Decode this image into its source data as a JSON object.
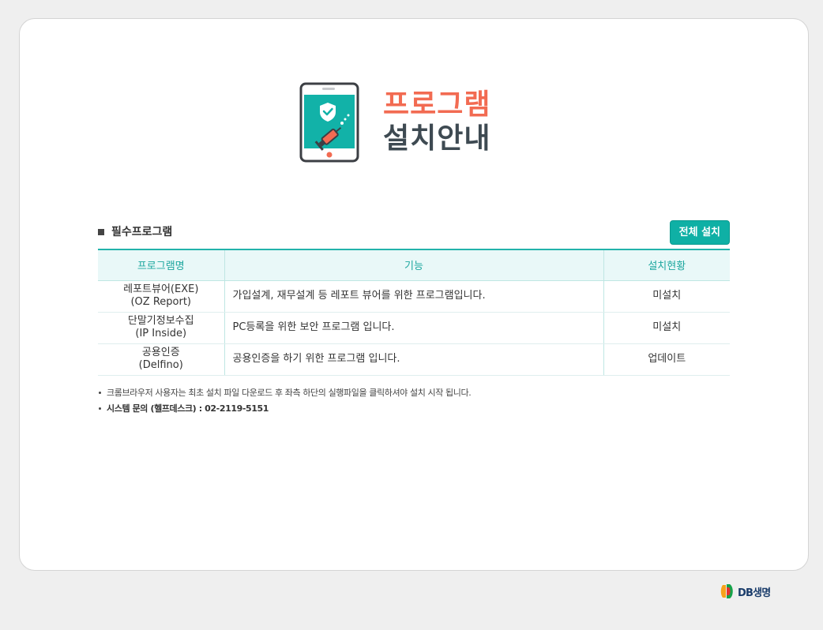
{
  "header": {
    "title": "프로그램",
    "subtitle": "설치안내"
  },
  "section": {
    "title": "필수프로그램",
    "install_all_label": "전체 설치"
  },
  "table": {
    "columns": [
      "프로그램명",
      "기능",
      "설치현황"
    ],
    "rows": [
      {
        "name": "레포트뷰어(EXE)",
        "sub": "(OZ Report)",
        "desc": "가입설계, 재무설계 등 레포트 뷰어를 위한 프로그램입니다.",
        "status": "미설치"
      },
      {
        "name": "단말기정보수집",
        "sub": "(IP Inside)",
        "desc": "PC등록을 위한 보안 프로그램 입니다.",
        "status": "미설치"
      },
      {
        "name": "공용인증",
        "sub": "(Delfino)",
        "desc": "공용인증을 하기 위한 프로그램 입니다.",
        "status": "업데이트"
      }
    ]
  },
  "notes": [
    "크롬브라우저 사용자는 최초 설치 파일 다운로드 후 좌측 하단의 실행파일을 클릭하셔야 설치 시작 됩니다.",
    "시스템 문의 (헬프데스크) : 02-2119-5151"
  ],
  "footer": {
    "logo_text": "DB생명"
  },
  "colors": {
    "accent": "#0fb0a5",
    "title": "#f26b52",
    "subtitle": "#3e4a52",
    "status": "#e8564a",
    "table_header_bg": "#e9f8f8"
  },
  "icons": {
    "hero": "phone-shield-syringe-icon",
    "logo": "db-logo-icon"
  }
}
